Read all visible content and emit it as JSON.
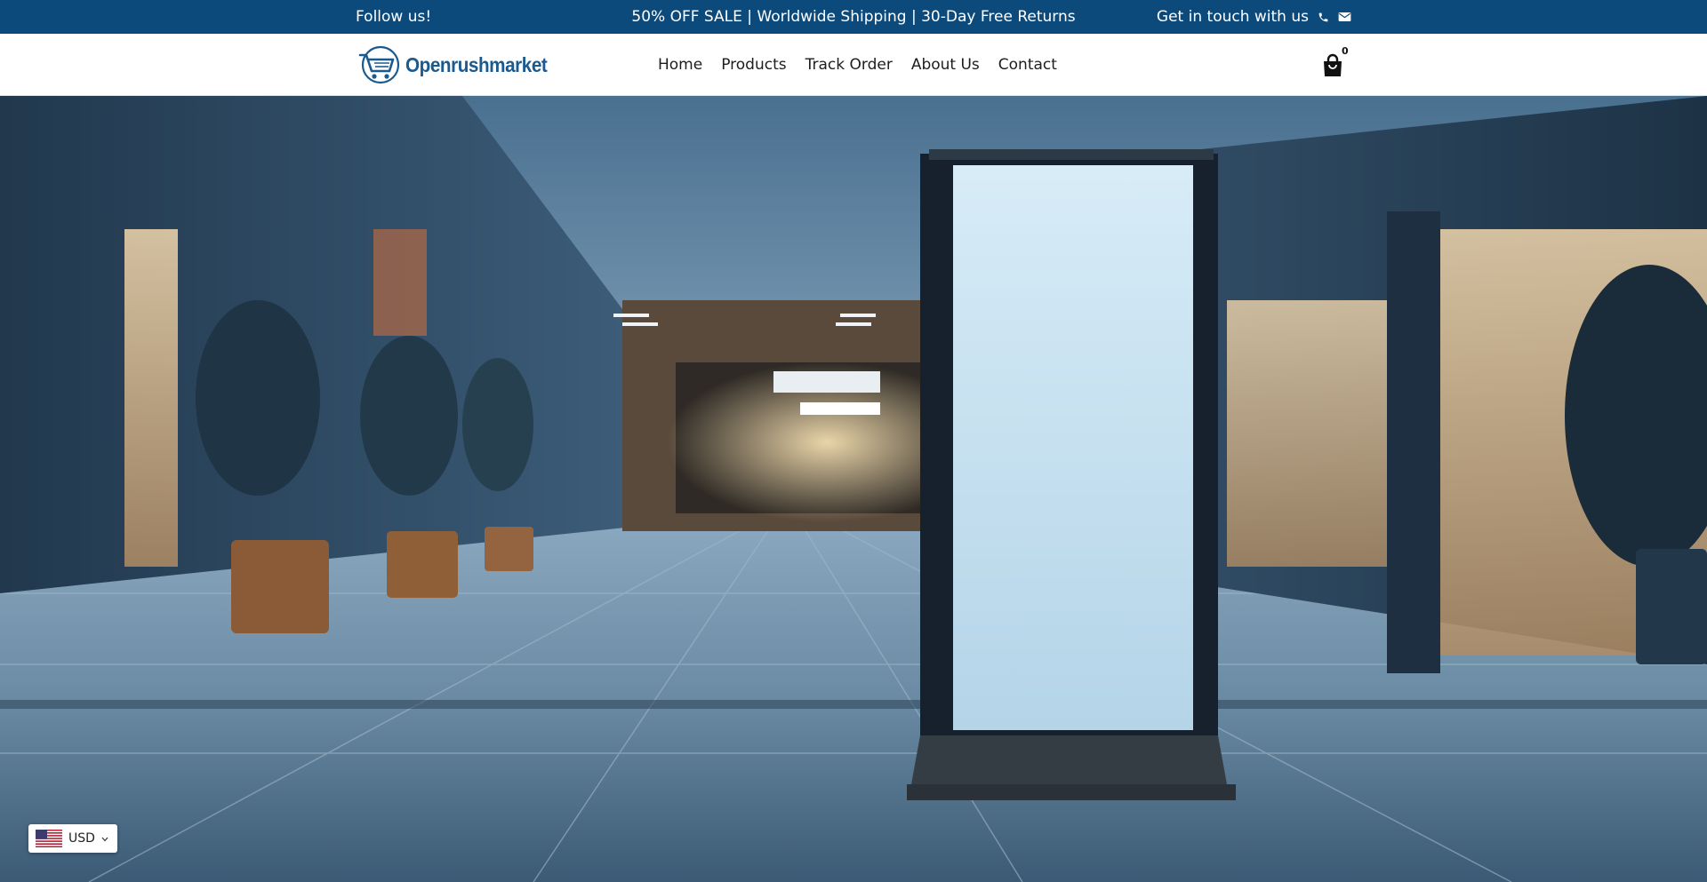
{
  "announcement": {
    "follow_text": "Follow us!",
    "promo_text": "50% OFF SALE | Worldwide Shipping | 30-Day Free Returns",
    "contact_text": "Get in touch with us",
    "icons": [
      "phone-icon",
      "mail-icon"
    ]
  },
  "header": {
    "logo_text": "Openrushmarket",
    "nav": [
      "Home",
      "Products",
      "Track Order",
      "About Us",
      "Contact"
    ],
    "cart_count": "0"
  },
  "currency": {
    "code": "USD"
  },
  "colors": {
    "announcement_bg": "#0c4a7c",
    "brand": "#1b5a8f"
  }
}
